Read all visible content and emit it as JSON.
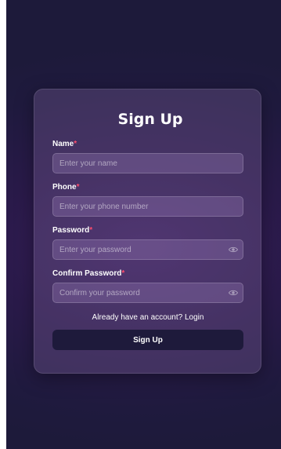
{
  "form": {
    "title": "Sign Up",
    "required_marker": "*",
    "fields": [
      {
        "label": "Name",
        "placeholder": "Enter your name",
        "value": ""
      },
      {
        "label": "Phone",
        "placeholder": "Enter your phone number",
        "value": ""
      },
      {
        "label": "Password",
        "placeholder": "Enter your password",
        "value": "",
        "icon": "eye-icon"
      },
      {
        "label": "Confirm Password",
        "placeholder": "Confirm your password",
        "value": "",
        "icon": "eye-icon"
      }
    ],
    "login_prompt": "Already have an account?",
    "login_link": "Login",
    "submit_label": "Sign Up"
  },
  "colors": {
    "background": "#1f1a3e",
    "required": "#ff4d6d",
    "button": "#1e1a3b",
    "text": "#ffffff"
  }
}
